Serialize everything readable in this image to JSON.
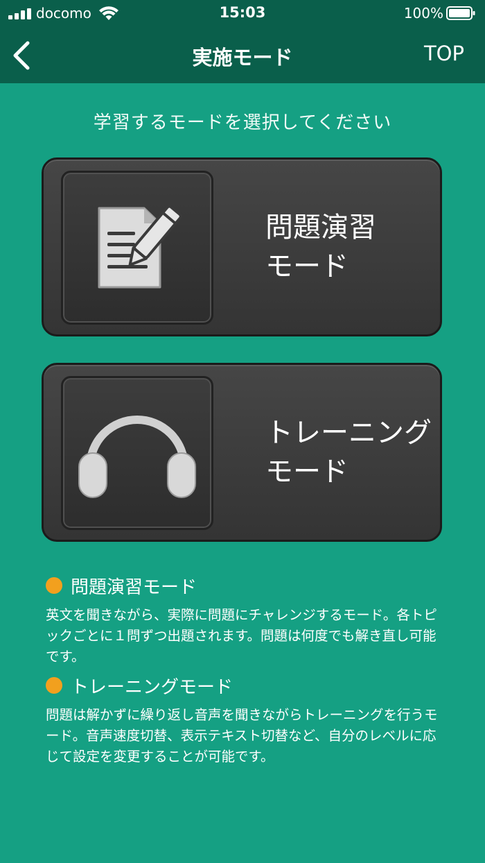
{
  "status_bar": {
    "carrier": "docomo",
    "time": "15:03",
    "battery_percent": "100%"
  },
  "nav": {
    "title": "実施モード",
    "top_label": "TOP"
  },
  "instruction": "学習するモードを選択してください",
  "modes": [
    {
      "label_line1": "問題演習",
      "label_line2": "モード",
      "icon": "document-pencil-icon"
    },
    {
      "label_line1": "トレーニング",
      "label_line2": "モード",
      "icon": "headphones-icon"
    }
  ],
  "descriptions": [
    {
      "heading": "問題演習モード",
      "text": "英文を聞きながら、実際に問題にチャレンジするモード。各トピックごとに１問ずつ出題されます。問題は何度でも解き直し可能です。"
    },
    {
      "heading": "トレーニングモード",
      "text": "問題は解かずに繰り返し音声を聞きながらトレーニングを行うモード。音声速度切替、表示テキスト切替など、自分のレベルに応じて設定を変更することが可能です。"
    }
  ],
  "colors": {
    "background": "#15a083",
    "header": "#0a5f4b",
    "card": "#3c3c3c",
    "bullet": "#f2a01e"
  }
}
